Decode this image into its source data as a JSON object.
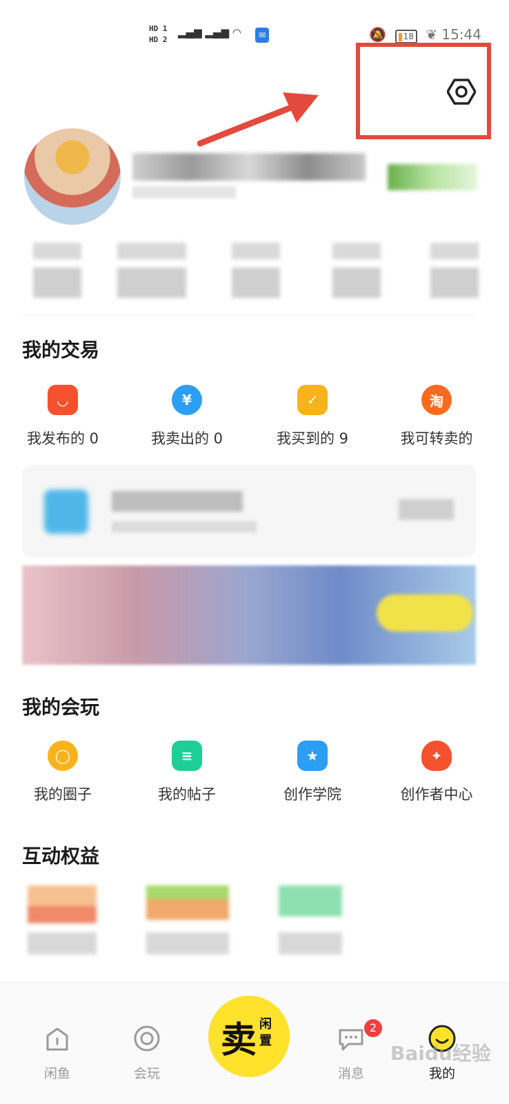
{
  "status_bar": {
    "sim_labels": [
      "HD 1",
      "HD 2"
    ],
    "battery": "18",
    "time": "15:44"
  },
  "settings": {
    "icon": "hexagon-settings-icon",
    "highlight_color": "#e34a3e"
  },
  "trade_section": {
    "title": "我的交易",
    "items": [
      {
        "label": "我发布的 0",
        "icon": "bag-icon",
        "color": "#f5512e"
      },
      {
        "label": "我卖出的 0",
        "icon": "yen-icon",
        "color": "#2c9ef3"
      },
      {
        "label": "我买到的 9",
        "icon": "note-check-icon",
        "color": "#f8b31a"
      },
      {
        "label": "我可转卖的",
        "icon": "taobao-icon",
        "color": "#f86a1e"
      }
    ]
  },
  "play_section": {
    "title": "我的会玩",
    "items": [
      {
        "label": "我的圈子",
        "icon": "circle-icon",
        "color": "#f8b31a"
      },
      {
        "label": "我的帖子",
        "icon": "post-icon",
        "color": "#1ecf95"
      },
      {
        "label": "创作学院",
        "icon": "star-icon",
        "color": "#2c9ef3"
      },
      {
        "label": "创作者中心",
        "icon": "bulb-icon",
        "color": "#f5512e"
      }
    ]
  },
  "rights_section": {
    "title": "互动权益"
  },
  "bottom_nav": {
    "items": [
      {
        "label": "闲鱼",
        "icon": "home-icon"
      },
      {
        "label": "会玩",
        "icon": "target-icon"
      },
      {
        "label": "消息",
        "icon": "chat-icon",
        "badge": "2"
      },
      {
        "label": "我的",
        "icon": "face-icon"
      }
    ],
    "sell": {
      "big": "卖",
      "small": "闲置",
      "color": "#ffe22c"
    }
  },
  "watermark": "Baidu经验"
}
